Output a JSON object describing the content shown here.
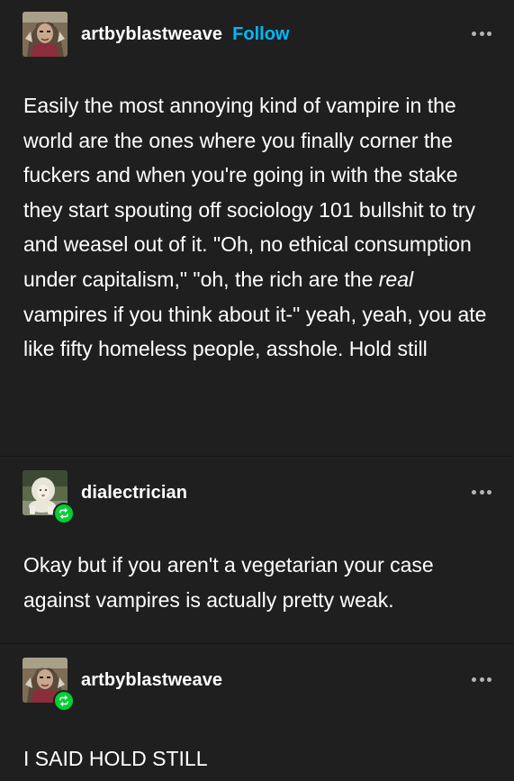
{
  "posts": [
    {
      "username": "artbyblastweave",
      "follow_label": "Follow",
      "avatar_icon": "painted-portrait-avatar",
      "more_icon": "more-options-icon",
      "text_parts": {
        "before_real": "Easily the most annoying kind of vampire in the world are the ones where you finally corner the fuckers and when you're going in with the stake they start spouting off sociology 101 bullshit to try and weasel out of it. \"Oh, no ethical consumption under capitalism,\" \"oh, the rich are the ",
        "italic": "real",
        "after_real": " vampires if you think about it-\" yeah, yeah, you ate like fifty homeless people, asshole. Hold still"
      }
    },
    {
      "username": "dialectrician",
      "avatar_icon": "white-lion-avatar",
      "badge_icon": "reblog-icon",
      "more_icon": "more-options-icon",
      "text": "Okay but if you aren't a vegetarian your case against vampires is actually pretty weak."
    },
    {
      "username": "artbyblastweave",
      "avatar_icon": "painted-portrait-avatar",
      "badge_icon": "reblog-icon",
      "more_icon": "more-options-icon",
      "text": "I SAID HOLD STILL"
    }
  ],
  "colors": {
    "background": "#1f1f1f",
    "text": "#ffffff",
    "follow": "#00b8ff",
    "reblog_badge": "#00cf35",
    "dots": "#b5b5b5"
  }
}
